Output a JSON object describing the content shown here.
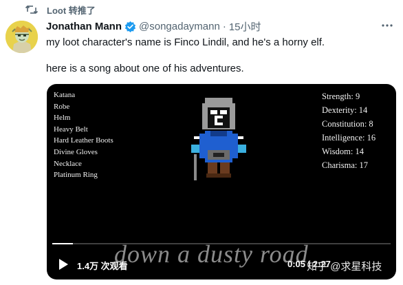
{
  "retweet": {
    "label": "Loot 转推了",
    "icon": "retweet-icon"
  },
  "author": {
    "name": "Jonathan Mann",
    "handle": "@songadaymann",
    "time": "15小时",
    "separator": "·",
    "verified_color": "#1d9bf0"
  },
  "tweet": {
    "line1": "my loot character's name is Finco Lindil, and he's a horny elf.",
    "line2": "here is a song about one of his adventures."
  },
  "video": {
    "items": [
      "Katana",
      "Robe",
      "Helm",
      "Heavy Belt",
      "Hard Leather Boots",
      "Divine Gloves",
      "Necklace",
      "Platinum Ring"
    ],
    "stats": [
      "Strength: 9",
      "Dexterity: 14",
      "Constitution: 8",
      "Intelligence: 16",
      "Wisdom: 14",
      "Charisma: 17"
    ],
    "lyric": "down a dusty road",
    "views": "1.4万 次观看",
    "timestamp": "0:05 / 2:27",
    "progress": 0.06
  },
  "watermark": "知乎 @求星科技",
  "colors": {
    "accent": "#1d9bf0",
    "secondary_text": "#536471",
    "video_bg": "#000000"
  }
}
